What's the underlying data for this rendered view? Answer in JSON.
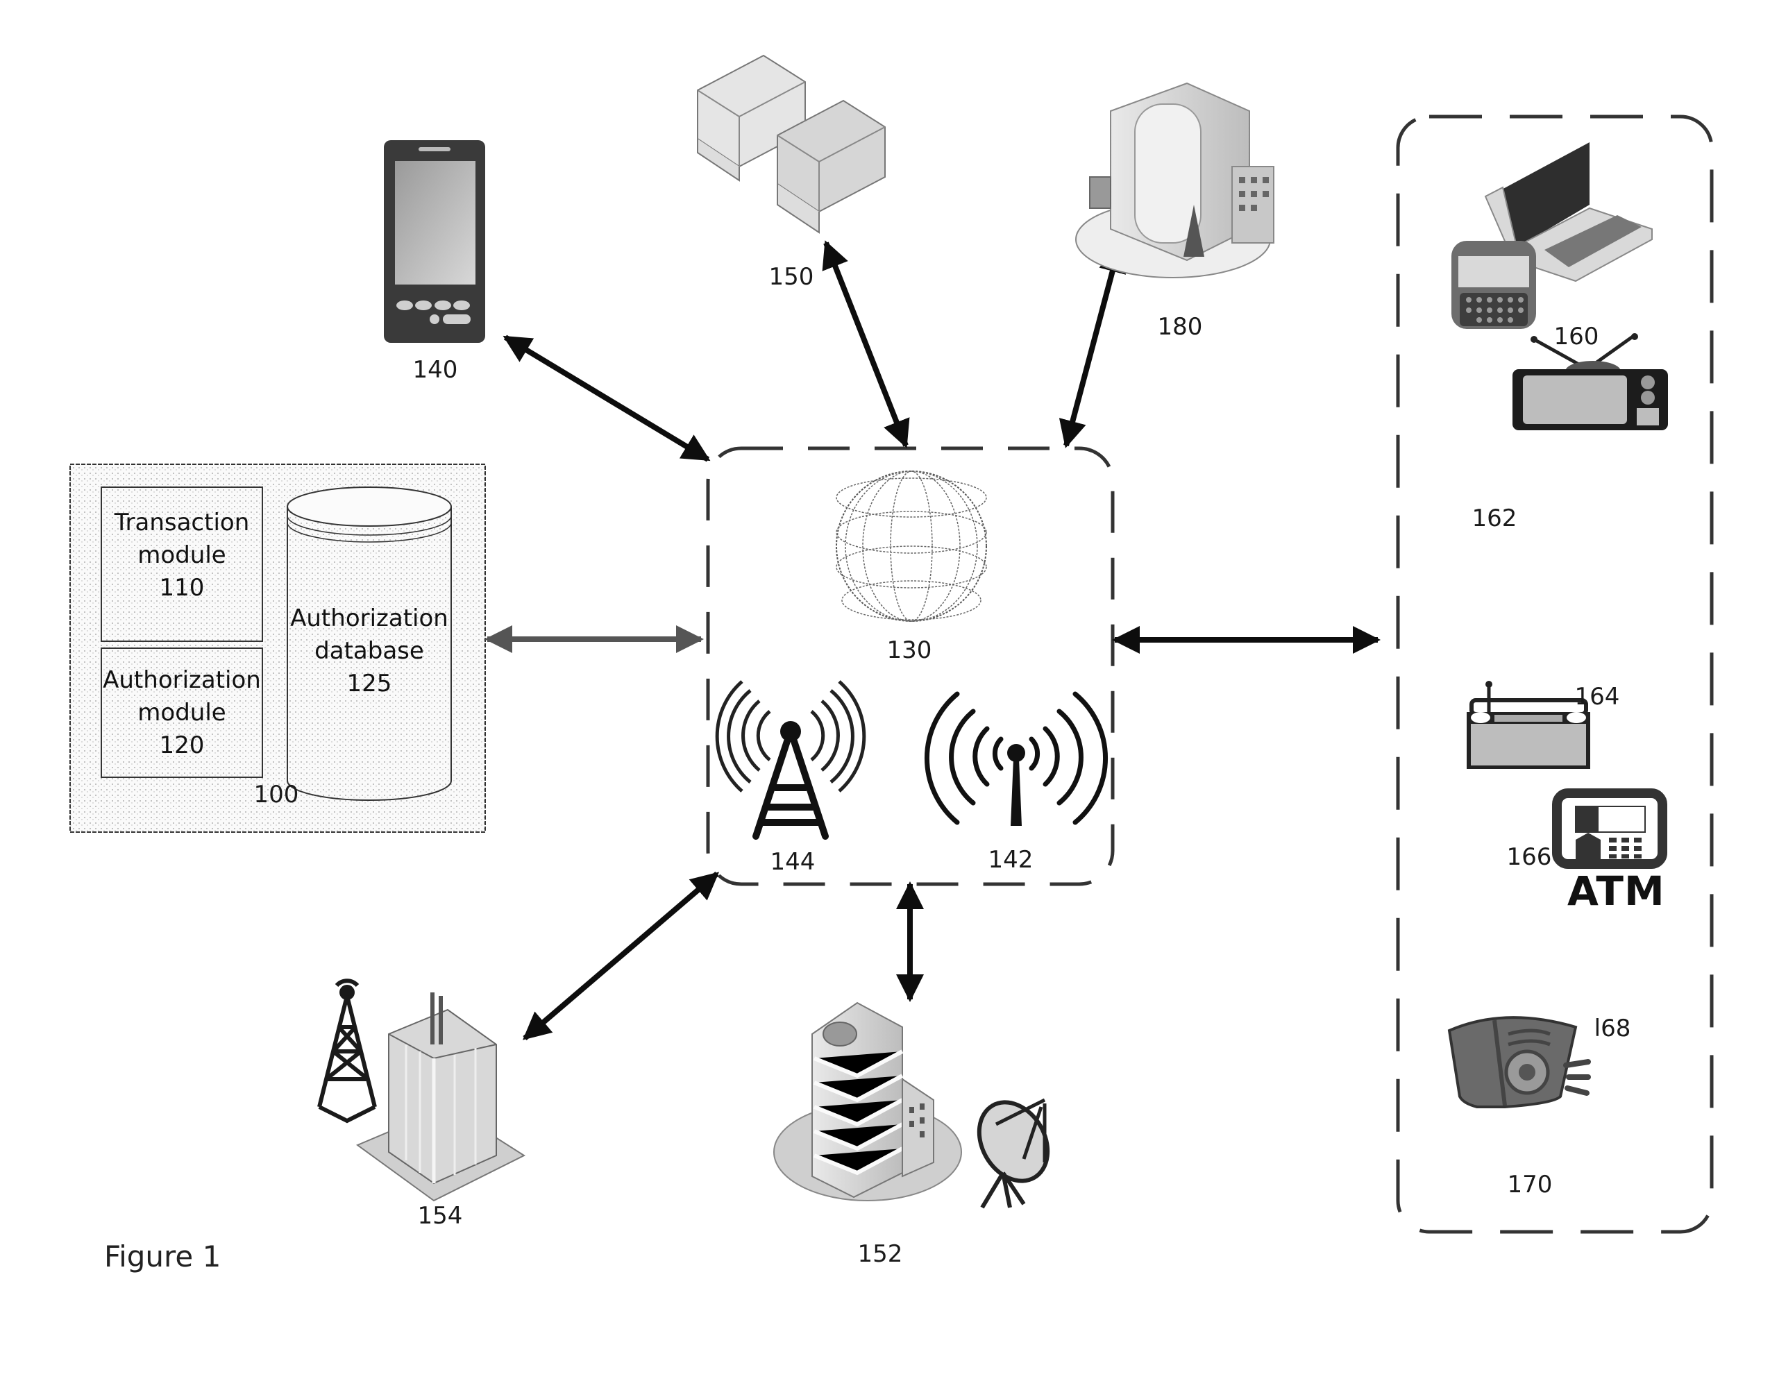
{
  "figure": {
    "caption": "Figure 1",
    "style": {
      "ink": "#111111",
      "gray_arrow": "#555555",
      "panel_fill": "#f2f2f2",
      "device_gray": "#7a7a7a",
      "device_dark": "#2b2b2b"
    }
  },
  "system": {
    "ref": "100",
    "components": [
      {
        "id": "transaction-module",
        "lines": [
          "Transaction",
          "module",
          "110"
        ]
      },
      {
        "id": "authorization-module",
        "lines": [
          "Authorization",
          "module",
          "120"
        ]
      },
      {
        "id": "authorization-database",
        "lines": [
          "Authorization",
          "database",
          "125"
        ]
      }
    ]
  },
  "network": {
    "ref": "130",
    "elements": [
      {
        "id": "internet-globe",
        "icon": "globe-icon",
        "ref": "130"
      },
      {
        "id": "cell-tower",
        "icon": "cell-tower-icon",
        "ref": "144"
      },
      {
        "id": "wireless-antenna",
        "icon": "antenna-icon",
        "ref": "142"
      }
    ]
  },
  "nodes": [
    {
      "id": "mobile-phone",
      "icon": "smartphone-icon",
      "ref": "140"
    },
    {
      "id": "server-rack",
      "icon": "server-icon",
      "ref": "150"
    },
    {
      "id": "office-building",
      "icon": "building-icon",
      "ref": "180"
    },
    {
      "id": "telecom-building",
      "icon": "tower-building-icon",
      "ref": "154"
    },
    {
      "id": "satellite-building",
      "icon": "satellite-building-icon",
      "ref": "152"
    }
  ],
  "devices": [
    {
      "id": "laptop",
      "icon": "laptop-icon",
      "ref": "160"
    },
    {
      "id": "feature-phone",
      "icon": "qwerty-phone-icon",
      "ref": "162"
    },
    {
      "id": "television",
      "icon": "tv-icon",
      "ref": "164"
    },
    {
      "id": "radio",
      "icon": "radio-icon",
      "ref": "166"
    },
    {
      "id": "atm",
      "icon": "atm-icon",
      "ref": "l68",
      "caption": "ATM"
    },
    {
      "id": "speaker",
      "icon": "speaker-icon",
      "ref": "170"
    }
  ],
  "connections": [
    {
      "from": "100",
      "to": "130",
      "style": "gray",
      "direction": "bidirectional"
    },
    {
      "from": "140",
      "to": "130",
      "style": "black",
      "direction": "bidirectional"
    },
    {
      "from": "150",
      "to": "130",
      "style": "black",
      "direction": "bidirectional"
    },
    {
      "from": "180",
      "to": "130",
      "style": "black",
      "direction": "bidirectional"
    },
    {
      "from": "154",
      "to": "130",
      "style": "black",
      "direction": "bidirectional"
    },
    {
      "from": "152",
      "to": "130",
      "style": "black",
      "direction": "bidirectional"
    },
    {
      "from": "130",
      "to": "devices",
      "style": "black",
      "direction": "bidirectional"
    }
  ]
}
